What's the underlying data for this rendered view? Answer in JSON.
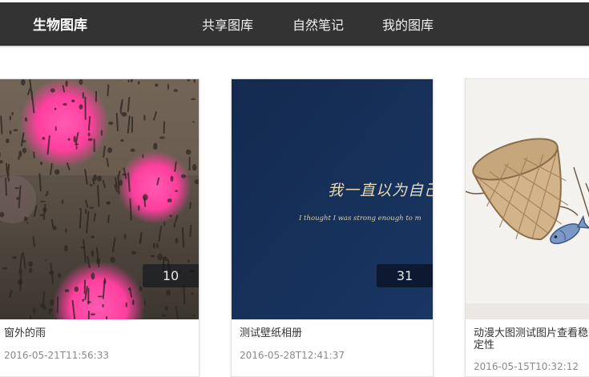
{
  "header": {
    "brand": "生物图库",
    "nav": [
      {
        "label": "共享图库"
      },
      {
        "label": "自然笔记"
      },
      {
        "label": "我的图库"
      }
    ]
  },
  "albums": [
    {
      "title": "窗外的雨",
      "date": "2016-05-21T11:56:33",
      "count": "10",
      "image": "rainy-window-bokeh-photo"
    },
    {
      "title": "测试壁纸相册",
      "date": "2016-05-28T12:41:37",
      "count": "31",
      "image": "dark-blue-handwriting-wallpaper",
      "image_text": {
        "line1": "我一直以为自己",
        "line2": "I thought I was strong enough to m"
      }
    },
    {
      "title": "动漫大图测试图片查看稳定性",
      "date": "2016-05-15T10:32:12",
      "image": "woven-basket-fish-illustration"
    }
  ],
  "colors": {
    "navbar": "#333333",
    "album2_bg": "#15305a",
    "rain_pink": "#ff4fa8"
  }
}
